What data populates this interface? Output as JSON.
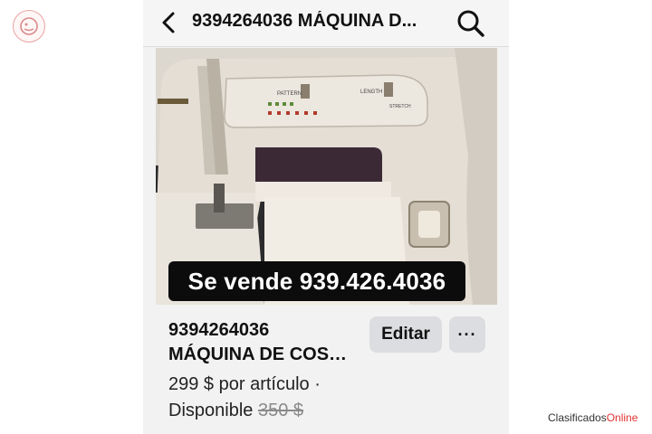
{
  "header": {
    "title": "9394264036 MÁQUINA D...",
    "back_icon": "chevron-left-icon",
    "search_icon": "search-icon"
  },
  "photo": {
    "caption": "Se vende  939.426.4036",
    "machine_labels": {
      "pattern": "PATTERN",
      "length": "LENGTH",
      "stretch": "STRETCH"
    }
  },
  "listing": {
    "title_line1": "9394264036",
    "title_line2": "MÁQUINA DE COS…",
    "price": "299 $ por artículo ·",
    "availability": "Disponible",
    "original_price": "350 $"
  },
  "actions": {
    "edit_label": "Editar",
    "more_label": "···"
  },
  "watermark": {
    "prefix": "Clasificados",
    "accent": "Online"
  },
  "colors": {
    "accent": "#e03232",
    "button_bg": "#dcdde0"
  }
}
